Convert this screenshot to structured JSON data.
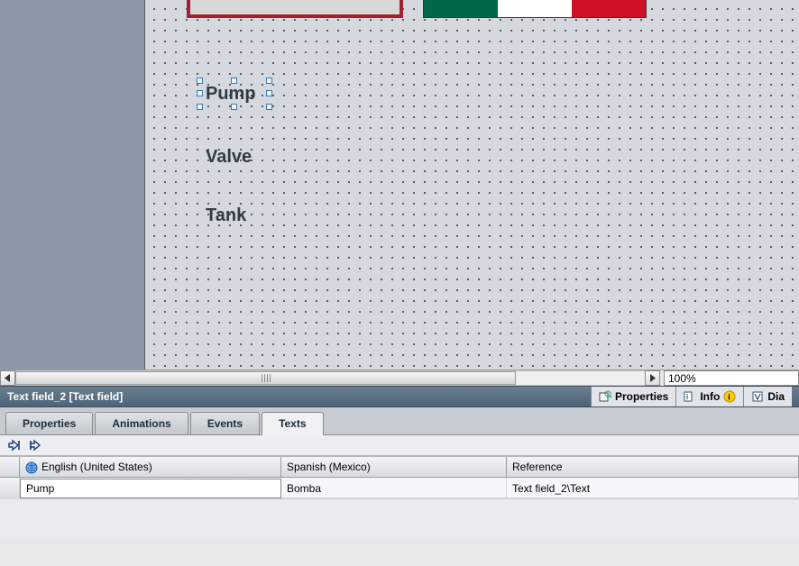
{
  "canvas": {
    "text_pump": "Pump",
    "text_valve": "Valve",
    "text_tank": "Tank"
  },
  "hscroll": {
    "zoom_value": "100%"
  },
  "inspector": {
    "object_title": "Text field_2 [Text field]",
    "tabs": {
      "properties": "Properties",
      "info": "Info",
      "diag": "Dia"
    }
  },
  "subtabs": {
    "properties": "Properties",
    "animations": "Animations",
    "events": "Events",
    "texts": "Texts"
  },
  "texts_grid": {
    "col_lang1": "English (United States)",
    "col_lang2": "Spanish (Mexico)",
    "col_ref": "Reference",
    "row1": {
      "lang1": "Pump",
      "lang2": "Bomba",
      "ref": "Text field_2\\Text"
    }
  }
}
